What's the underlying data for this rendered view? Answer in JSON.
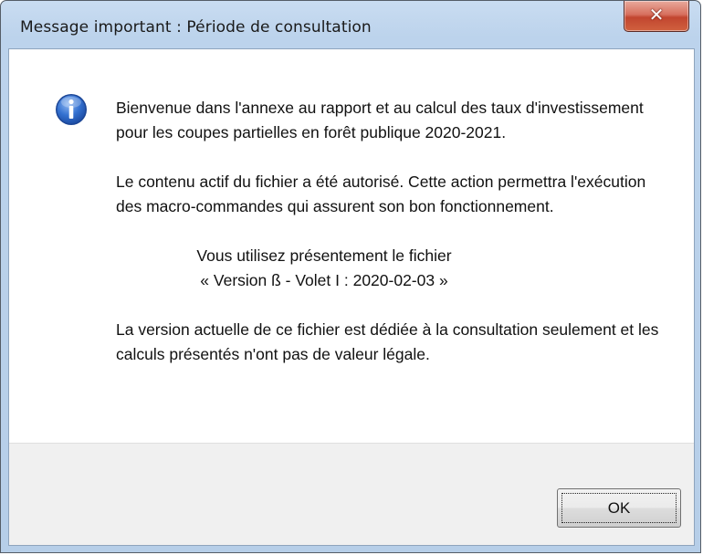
{
  "window": {
    "title": "Message important : Période de consultation"
  },
  "icons": {
    "close": "close-icon",
    "info": "info-icon"
  },
  "message": {
    "paragraph1": "Bienvenue dans l'annexe au rapport et au calcul des taux d'investissement pour les coupes partielles en forêt publique 2020-2021.",
    "paragraph2": "Le contenu actif du fichier a été autorisé. Cette action permettra l'exécution des macro-commandes qui assurent son bon fonctionnement.",
    "version_line1": "Vous utilisez présentement le fichier",
    "version_line2": "« Version ß - Volet I : 2020-02-03 »",
    "paragraph4": "La version actuelle de ce fichier est dédiée à la consultation seulement et les calculs présentés n'ont pas de valeur légale."
  },
  "buttons": {
    "ok_label": "OK"
  },
  "colors": {
    "accent_info": "#2a66c9",
    "close_button": "#c9452f"
  }
}
